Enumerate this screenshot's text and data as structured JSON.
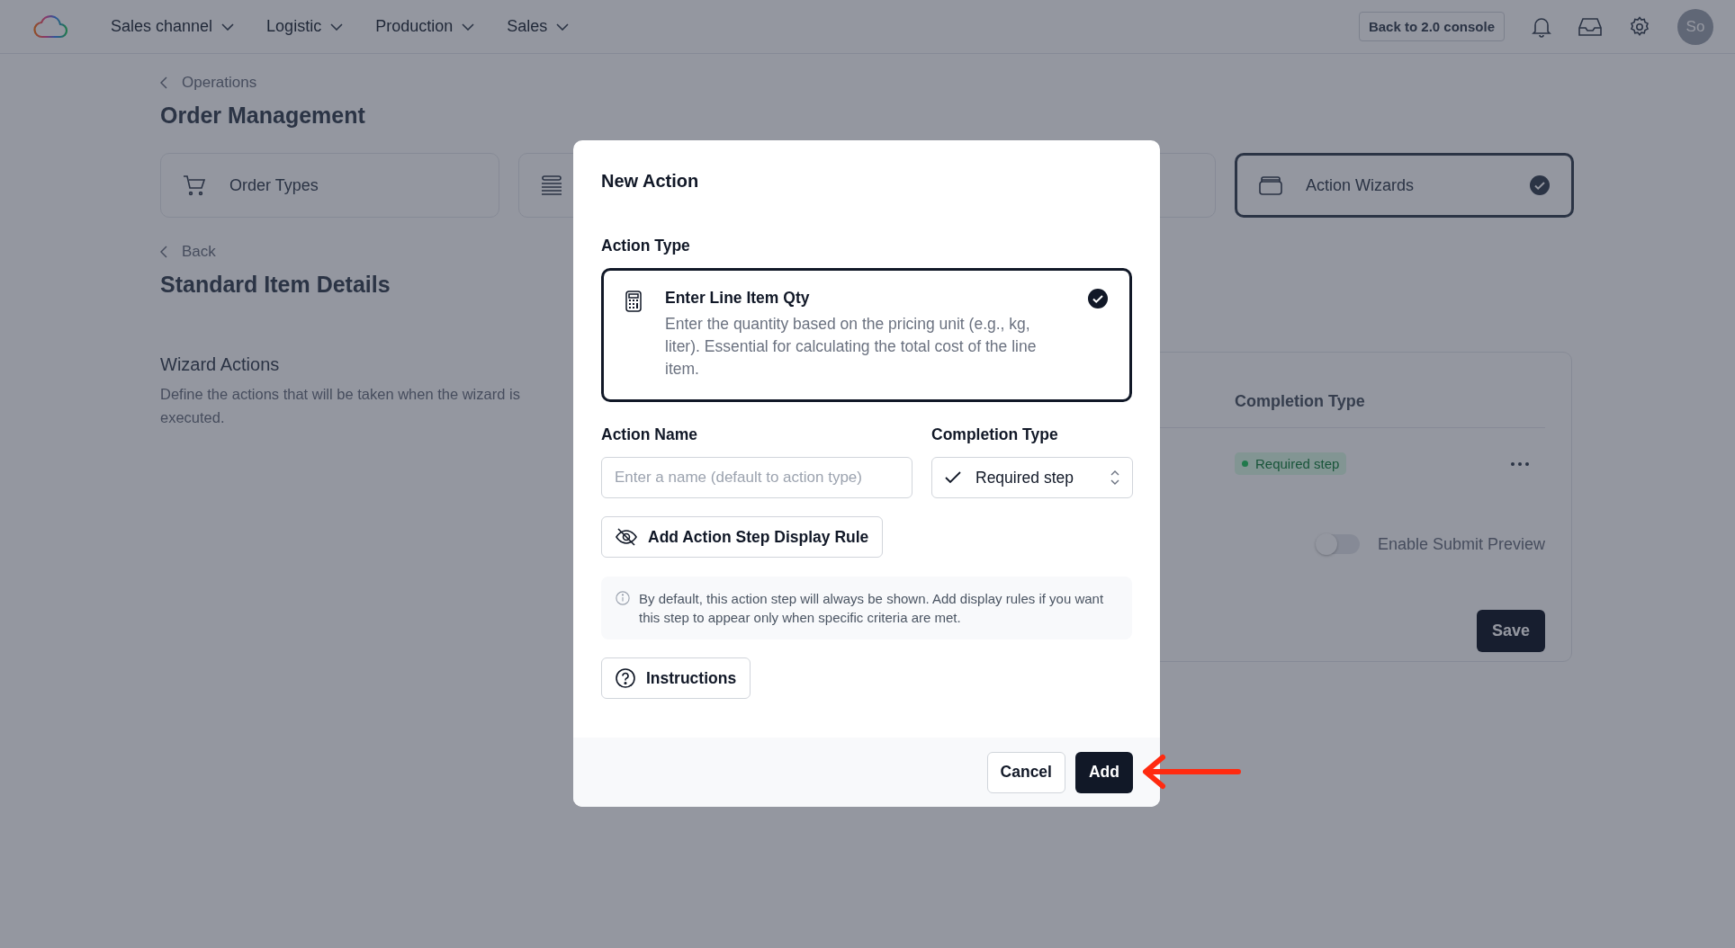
{
  "nav": {
    "items": [
      {
        "label": "Sales channel"
      },
      {
        "label": "Logistic"
      },
      {
        "label": "Production"
      },
      {
        "label": "Sales"
      }
    ],
    "console_button": "Back to 2.0 console",
    "avatar": "So"
  },
  "page": {
    "breadcrumb": "Operations",
    "title": "Order Management",
    "cards": [
      {
        "label": "Order Types",
        "selected": false
      },
      {
        "selected": false
      },
      {
        "selected": false
      },
      {
        "label": "Action Wizards",
        "selected": true
      }
    ],
    "back": "Back",
    "subtitle": "Standard Item Details",
    "section": {
      "title": "Wizard Actions",
      "description": "Define the actions that will be taken when the wizard is executed."
    },
    "table": {
      "columns": [
        "Completion Type"
      ],
      "rows": [
        {
          "completion": "Required step",
          "color": "#21794c"
        }
      ]
    },
    "toggle": {
      "label": "Enable Submit Preview",
      "on": false
    },
    "save_button": "Save"
  },
  "modal": {
    "title": "New Action",
    "action_type_label": "Action Type",
    "options": [
      {
        "title": "Enter Line Item Qty",
        "description": "Enter the quantity based on the pricing unit (e.g., kg, liter). Essential for calculating the total cost of the line item.",
        "selected": true
      }
    ],
    "name_label": "Action Name",
    "name_field": {
      "placeholder": "Enter a name (default to action type)"
    },
    "completion_label": "Completion Type",
    "completion_value": "Required step",
    "display_rule_button": "Add Action Step Display Rule",
    "info": "By default, this action step will always be shown. Add display rules if you want this step to appear only when specific criteria are met.",
    "instructions_button": "Instructions",
    "cancel_button": "Cancel",
    "add_button": "Add"
  }
}
